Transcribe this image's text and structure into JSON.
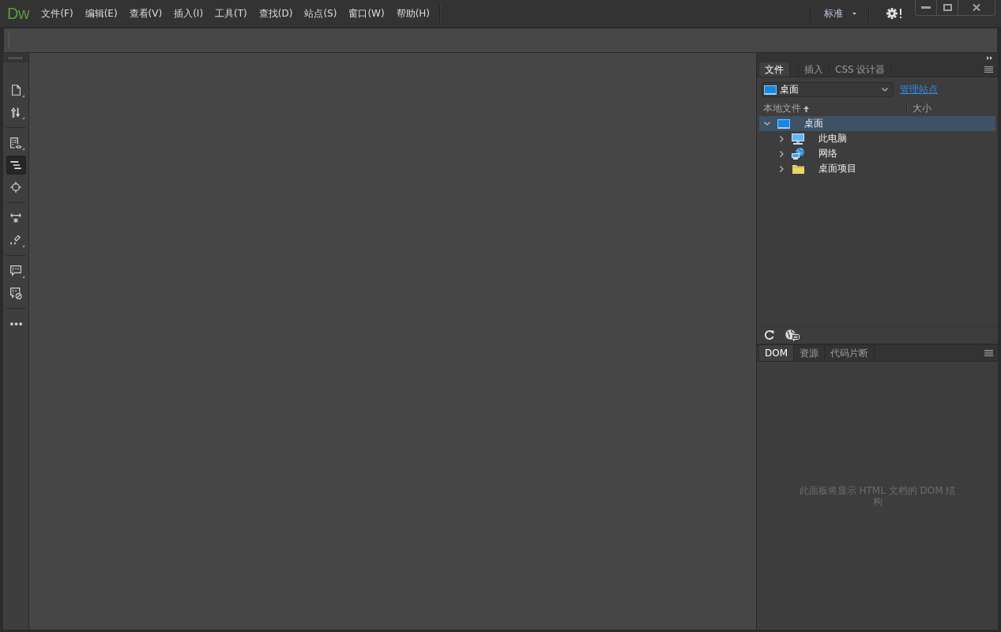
{
  "app": {
    "logo": "Dw"
  },
  "menu": [
    {
      "label": "文件(F)"
    },
    {
      "label": "编辑(E)"
    },
    {
      "label": "查看(V)"
    },
    {
      "label": "插入(I)"
    },
    {
      "label": "工具(T)"
    },
    {
      "label": "查找(D)"
    },
    {
      "label": "站点(S)"
    },
    {
      "label": "窗口(W)"
    },
    {
      "label": "帮助(H)"
    }
  ],
  "workspace": {
    "label": "标准"
  },
  "tool_groups": [
    {
      "tools": [
        {
          "kind": "file",
          "selected": false,
          "flyout": true
        },
        {
          "kind": "transfer",
          "selected": false,
          "flyout": true
        }
      ]
    },
    {
      "tools": [
        {
          "kind": "preview",
          "selected": false,
          "flyout": true
        },
        {
          "kind": "outline",
          "selected": true,
          "flyout": false
        },
        {
          "kind": "inspect",
          "selected": false,
          "flyout": false
        }
      ]
    },
    {
      "tools": [
        {
          "kind": "expand",
          "selected": false,
          "flyout": false
        },
        {
          "kind": "format",
          "selected": false,
          "flyout": true
        }
      ]
    },
    {
      "tools": [
        {
          "kind": "comment",
          "selected": false,
          "flyout": true
        },
        {
          "kind": "uncomment",
          "selected": false,
          "flyout": false
        }
      ]
    },
    {
      "tools": [
        {
          "kind": "more",
          "selected": false,
          "flyout": false
        }
      ]
    }
  ],
  "files_panel": {
    "tabs": [
      {
        "label": "文件",
        "selected": true
      },
      {
        "label": "插入",
        "selected": false
      },
      {
        "label": "CSS 设计器",
        "selected": false
      }
    ],
    "site": {
      "value": "桌面"
    },
    "manage_link": "管理站点",
    "columns": [
      {
        "label": "本地文件",
        "sorted": true
      },
      {
        "label": "大小",
        "sorted": false
      }
    ],
    "tree": [
      {
        "kind": "desktop",
        "label": "桌面",
        "expanded": true,
        "selected": true,
        "children": [
          {
            "kind": "computer",
            "label": "此电脑",
            "expanded": false,
            "selected": false
          },
          {
            "kind": "network",
            "label": "网络",
            "expanded": false,
            "selected": false
          },
          {
            "kind": "folder",
            "label": "桌面项目",
            "expanded": false,
            "selected": false
          }
        ]
      }
    ]
  },
  "dom_panel": {
    "tabs": [
      {
        "label": "DOM",
        "selected": true
      },
      {
        "label": "资源",
        "selected": false
      },
      {
        "label": "代码片断",
        "selected": false
      }
    ],
    "message": "此面板将显示 HTML 文档的 DOM 结构"
  }
}
